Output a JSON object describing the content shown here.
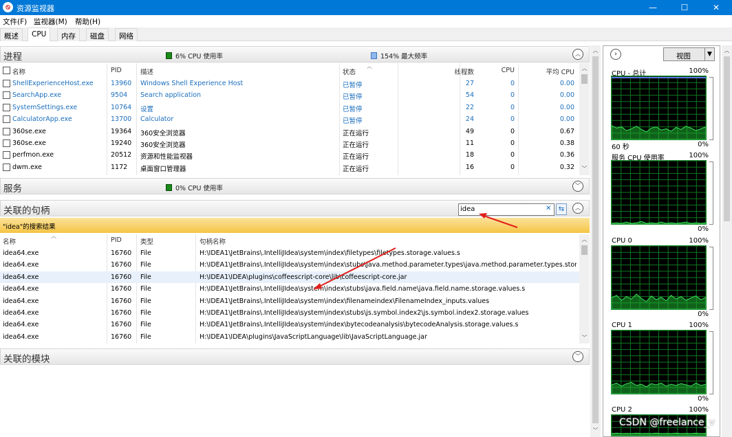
{
  "window": {
    "title": "资源监视器",
    "minimize": "—",
    "maximize": "☐",
    "close": "✕"
  },
  "menu": [
    "文件(F)",
    "监视器(M)",
    "帮助(H)"
  ],
  "tabs": [
    "概述",
    "CPU",
    "内存",
    "磁盘",
    "网络"
  ],
  "processes": {
    "title": "进程",
    "cpu_usage": "6% CPU 使用率",
    "max_freq": "154% 最大频率",
    "columns": [
      "名称",
      "PID",
      "描述",
      "状态",
      "线程数",
      "CPU",
      "平均 CPU"
    ],
    "rows": [
      {
        "name": "ShellExperienceHost.exe",
        "pid": "13960",
        "desc": "Windows Shell Experience Host",
        "status": "已暂停",
        "threads": "27",
        "cpu": "0",
        "avg": "0.00",
        "suspended": true
      },
      {
        "name": "SearchApp.exe",
        "pid": "9504",
        "desc": "Search application",
        "status": "已暂停",
        "threads": "54",
        "cpu": "0",
        "avg": "0.00",
        "suspended": true
      },
      {
        "name": "SystemSettings.exe",
        "pid": "10764",
        "desc": "设置",
        "status": "已暂停",
        "threads": "22",
        "cpu": "0",
        "avg": "0.00",
        "suspended": true
      },
      {
        "name": "CalculatorApp.exe",
        "pid": "13700",
        "desc": "Calculator",
        "status": "已暂停",
        "threads": "24",
        "cpu": "0",
        "avg": "0.00",
        "suspended": true
      },
      {
        "name": "360se.exe",
        "pid": "19364",
        "desc": "360安全浏览器",
        "status": "正在运行",
        "threads": "49",
        "cpu": "0",
        "avg": "0.67",
        "suspended": false
      },
      {
        "name": "360se.exe",
        "pid": "19240",
        "desc": "360安全浏览器",
        "status": "正在运行",
        "threads": "11",
        "cpu": "0",
        "avg": "0.38",
        "suspended": false
      },
      {
        "name": "perfmon.exe",
        "pid": "20512",
        "desc": "资源和性能监视器",
        "status": "正在运行",
        "threads": "18",
        "cpu": "0",
        "avg": "0.36",
        "suspended": false
      },
      {
        "name": "dwm.exe",
        "pid": "1172",
        "desc": "桌面窗口管理器",
        "status": "正在运行",
        "threads": "16",
        "cpu": "0",
        "avg": "0.32",
        "suspended": false
      }
    ]
  },
  "services": {
    "title": "服务",
    "cpu_usage": "0% CPU 使用率"
  },
  "handles": {
    "title": "关联的句柄",
    "search_value": "idea",
    "search_result": "\"idea\"的搜索结果",
    "columns": [
      "名称",
      "PID",
      "类型",
      "句柄名称"
    ],
    "rows": [
      {
        "name": "idea64.exe",
        "pid": "16760",
        "type": "File",
        "handle": "H:\\IDEA1\\JetBrains\\.IntelliJIdea\\system\\index\\filetypes\\filetypes.storage.values.s"
      },
      {
        "name": "idea64.exe",
        "pid": "16760",
        "type": "File",
        "handle": "H:\\IDEA1\\JetBrains\\.IntelliJIdea\\system\\index\\stubs\\java.method.parameter.types\\java.method.parameter.types.stora..."
      },
      {
        "name": "idea64.exe",
        "pid": "16760",
        "type": "File",
        "handle": "H:\\IDEA1\\IDEA\\plugins\\coffeescript-core\\lib\\coffeescript-core.jar"
      },
      {
        "name": "idea64.exe",
        "pid": "16760",
        "type": "File",
        "handle": "H:\\IDEA1\\JetBrains\\.IntelliJIdea\\system\\index\\stubs\\java.field.name\\java.field.name.storage.values.s"
      },
      {
        "name": "idea64.exe",
        "pid": "16760",
        "type": "File",
        "handle": "H:\\IDEA1\\JetBrains\\.IntelliJIdea\\system\\index\\filenameindex\\FilenameIndex_inputs.values"
      },
      {
        "name": "idea64.exe",
        "pid": "16760",
        "type": "File",
        "handle": "H:\\IDEA1\\JetBrains\\.IntelliJIdea\\system\\index\\stubs\\js.symbol.index2\\js.symbol.index2.storage.values"
      },
      {
        "name": "idea64.exe",
        "pid": "16760",
        "type": "File",
        "handle": "H:\\IDEA1\\JetBrains\\.IntelliJIdea\\system\\index\\bytecodeanalysis\\bytecodeAnalysis.storage.values.s"
      },
      {
        "name": "idea64.exe",
        "pid": "16760",
        "type": "File",
        "handle": "H:\\IDEA1\\IDEA\\plugins\\JavaScriptLanguage\\lib\\JavaScriptLanguage.jar"
      }
    ]
  },
  "modules": {
    "title": "关联的模块"
  },
  "right_panel": {
    "view_label": "视图",
    "graphs": [
      {
        "title": "CPU - 总计",
        "top": "100%",
        "bottom": "0%",
        "caption_left": "60 秒"
      },
      {
        "title": "服务 CPU 使用率",
        "top": "100%",
        "bottom": "0%"
      },
      {
        "title": "CPU 0",
        "top": "100%",
        "bottom": "0%"
      },
      {
        "title": "CPU 1",
        "top": "100%",
        "bottom": "0%"
      },
      {
        "title": "CPU 2",
        "top": "100%",
        "bottom": ""
      }
    ]
  },
  "watermark": "CSDN @freelance_v",
  "colors": {
    "accent": "#0078d7",
    "link": "#1a6ebd",
    "graph_green": "#1db332",
    "banner": "#f7c84a"
  }
}
